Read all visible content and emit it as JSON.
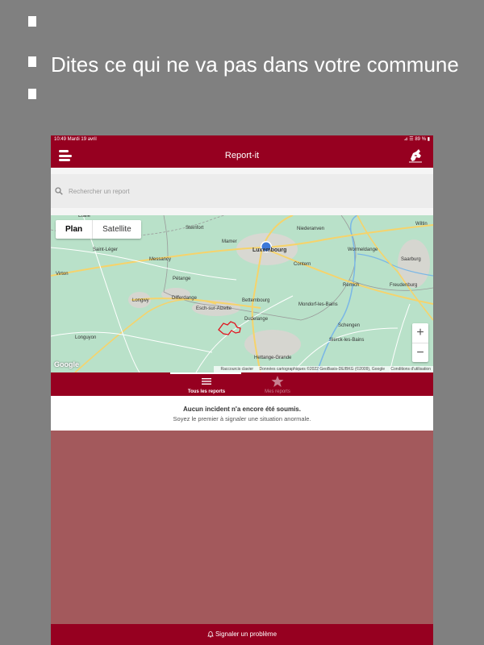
{
  "promo": {
    "headline": "Dites ce qui ne va pas dans votre commune"
  },
  "status_bar": {
    "time_date": "10:49  Mardi 19 avril",
    "indicators": "⊿ ☰ 89 % ▮"
  },
  "navbar": {
    "title": "Report-it"
  },
  "search": {
    "placeholder": "Rechercher un report"
  },
  "map": {
    "type_options": [
      "Plan",
      "Satellite"
    ],
    "selected_type": "Plan",
    "zoom_in": "+",
    "zoom_out": "−",
    "google": "Google",
    "attribution": {
      "shortcuts": "Raccourcis clavier",
      "data": "Données cartographiques ©2022 GeoBasis-DE/BKG (©2009), Google",
      "terms": "Conditions d'utilisation"
    },
    "places": [
      "Etalle",
      "Steinfort",
      "Niederanven",
      "Mamer",
      "Luxembourg",
      "Saint-Léger",
      "Messancy",
      "Contern",
      "Wormeldange",
      "Virton",
      "Pétange",
      "Longwy",
      "Differdange",
      "Remich",
      "Bettembourg",
      "Mondorf-les-Bains",
      "Freudenburg",
      "Esch-sur-Alzette",
      "Dudelange",
      "Schengen",
      "Longuyon",
      "Sierck-les-Bains",
      "Hettange-Grande",
      "Saarburg",
      "Wiltin"
    ]
  },
  "tabs": {
    "all_reports": "Tous les reports",
    "my_reports": "Mes reports"
  },
  "empty_state": {
    "title": "Aucun incident n'a encore été soumis.",
    "subtitle": "Soyez le premier à signaler une situation anormale."
  },
  "bottom_button": {
    "label": "Signaler un problème"
  },
  "colors": {
    "brand": "#960020",
    "background": "#808080",
    "content_fill": "#a3595c",
    "map_land": "#b8e0c8",
    "location_dot": "#3b78d8"
  }
}
